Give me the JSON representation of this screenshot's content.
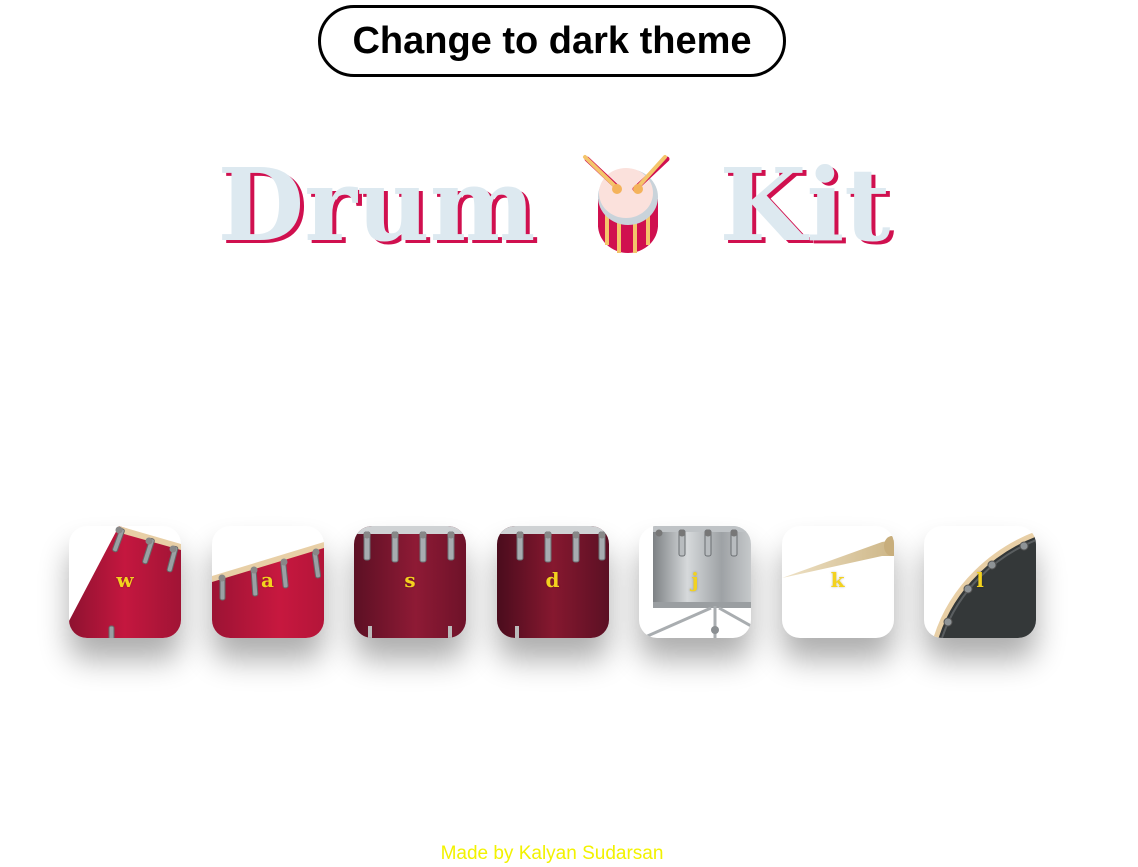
{
  "theme_button": {
    "label": "Change to dark theme"
  },
  "title": {
    "left_word": "Drum",
    "right_word": "Kit",
    "icon": "drum-icon"
  },
  "pads": [
    {
      "key": "w",
      "drum": "tom-icon"
    },
    {
      "key": "a",
      "drum": "tom-icon"
    },
    {
      "key": "s",
      "drum": "snare-icon"
    },
    {
      "key": "d",
      "drum": "snare-icon"
    },
    {
      "key": "j",
      "drum": "hihat-stand-icon"
    },
    {
      "key": "k",
      "drum": "drumstick-icon"
    },
    {
      "key": "l",
      "drum": "kick-drum-icon"
    }
  ],
  "footer": {
    "text": "Made by Kalyan Sudarsan"
  },
  "colors": {
    "title_fill": "#dde9f0",
    "title_shadow": "#d0104f",
    "key_label": "#f3d21e",
    "footer_text": "#f2f200",
    "drum_red": "#b3173e"
  }
}
